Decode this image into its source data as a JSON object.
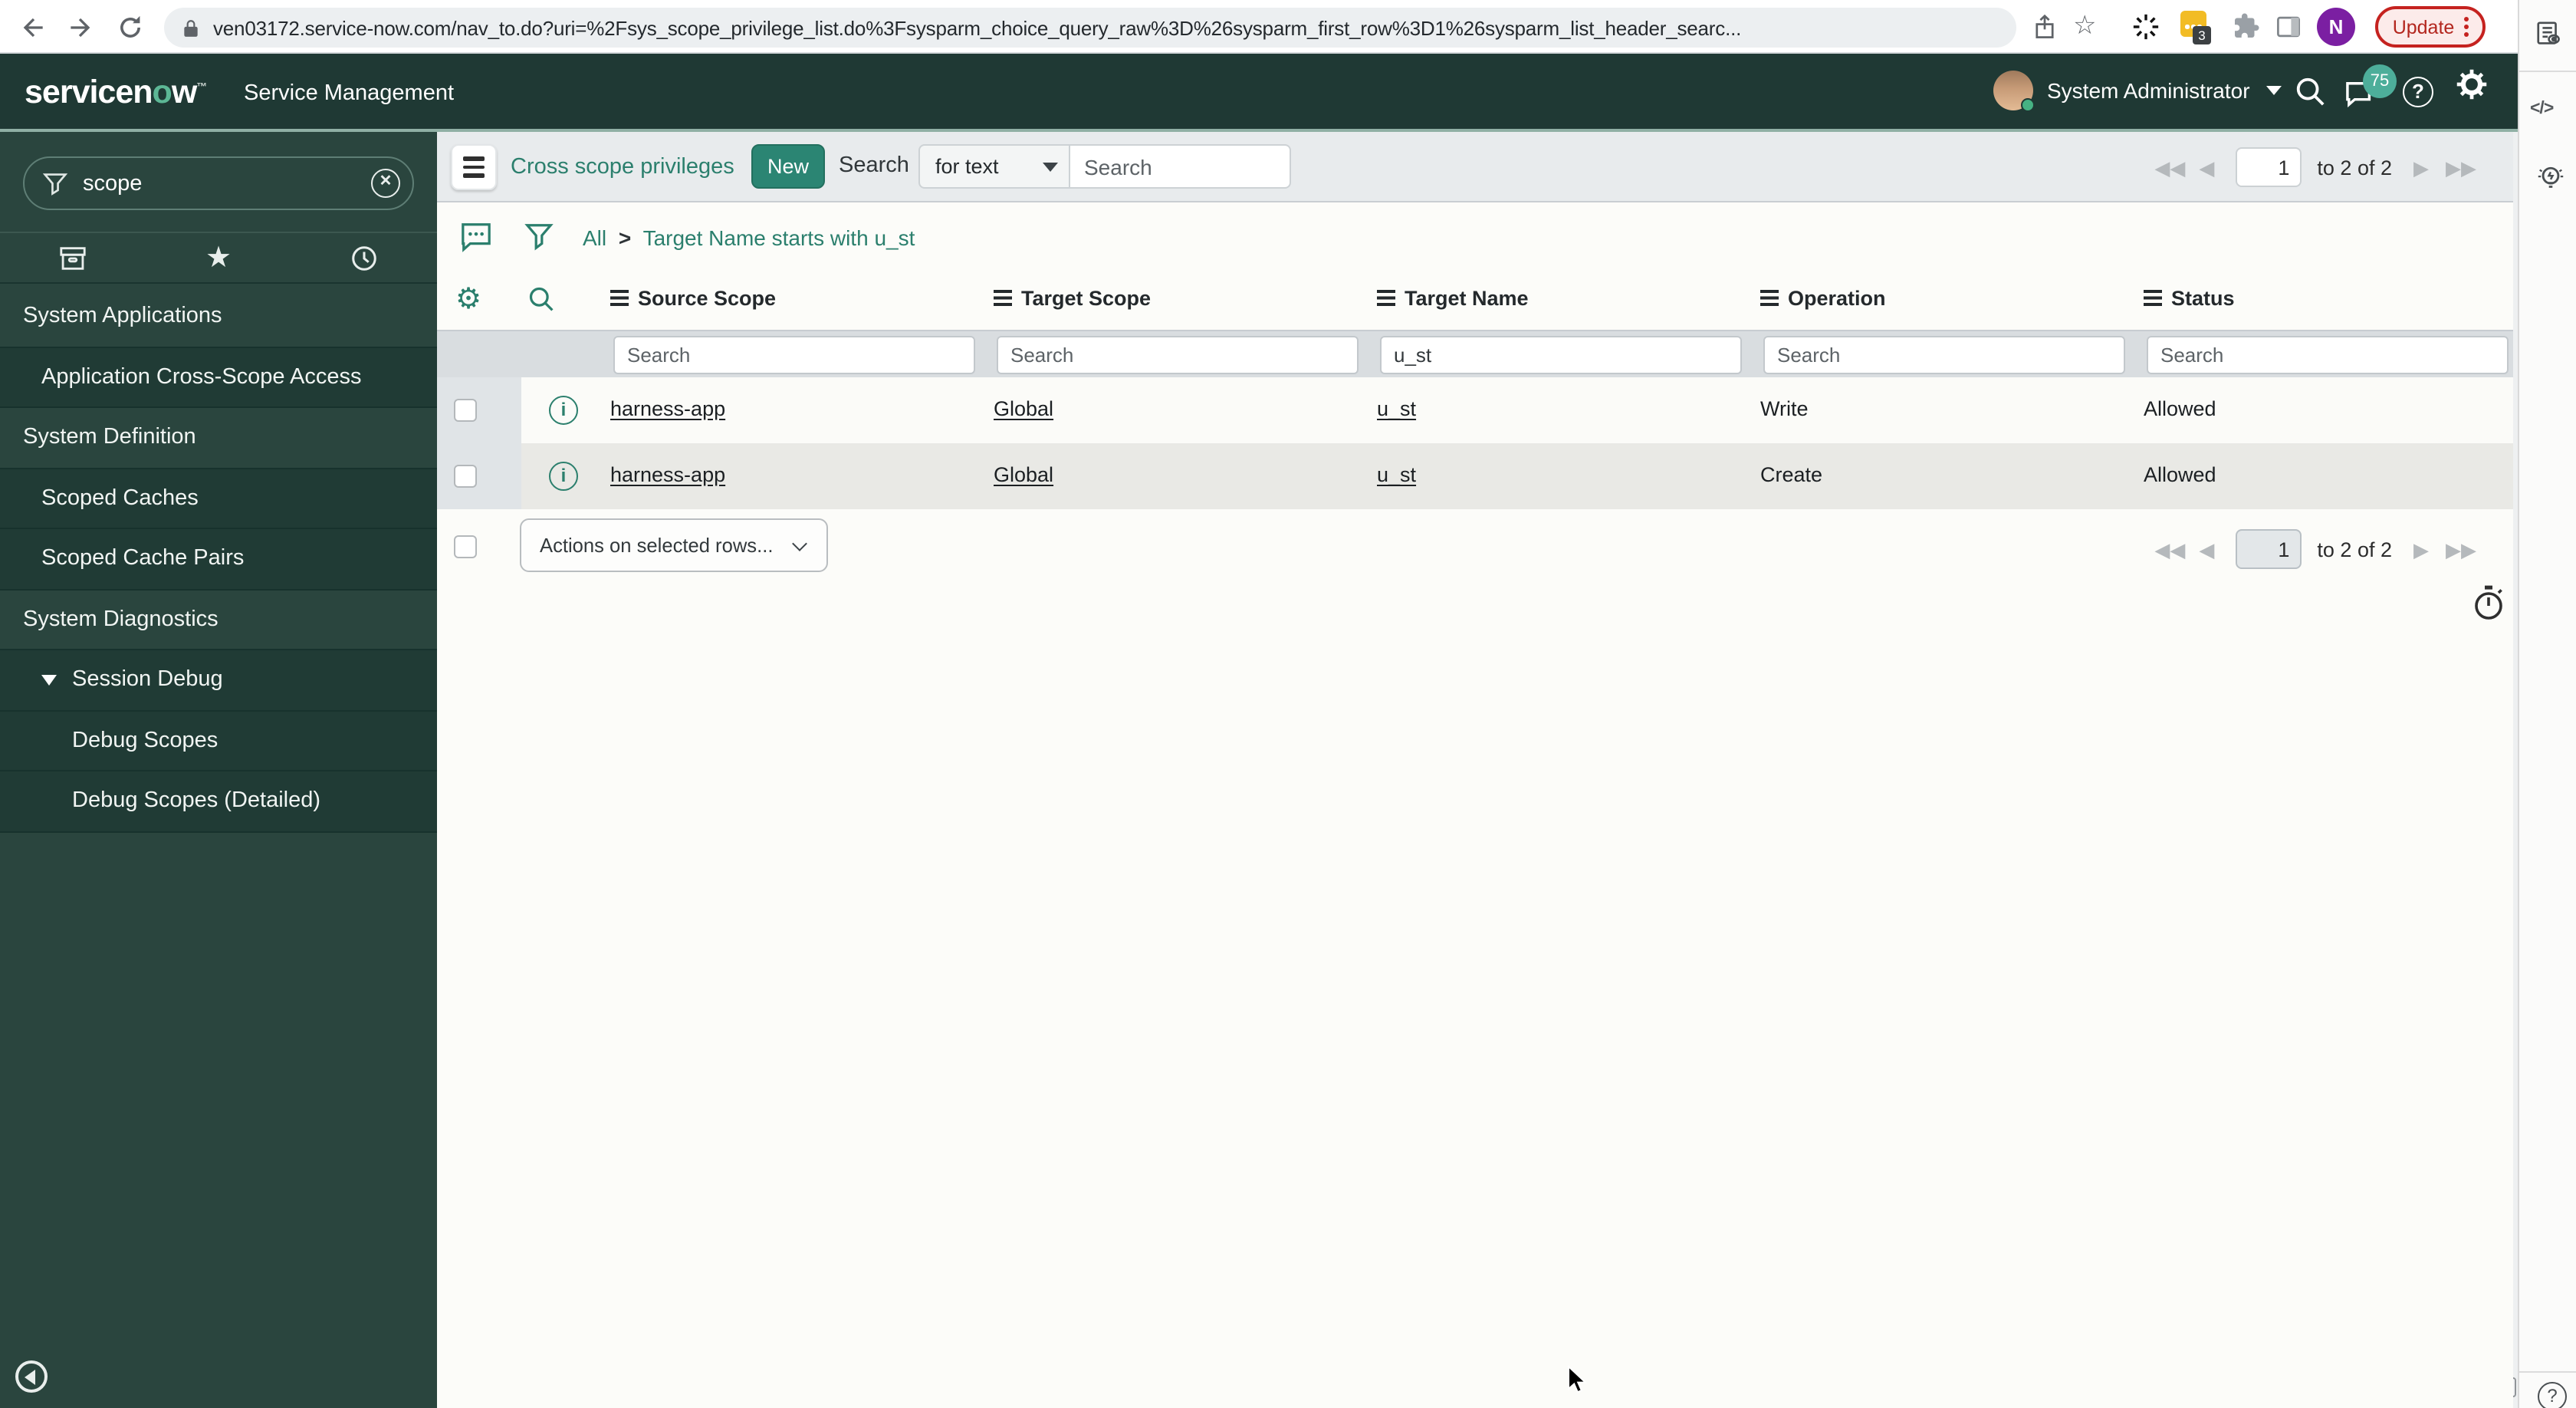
{
  "browser": {
    "url": "ven03172.service-now.com/nav_to.do?uri=%2Fsys_scope_privilege_list.do%3Fsysparm_choice_query_raw%3D%26sysparm_first_row%3D1%26sysparm_list_header_searc...",
    "update_label": "Update",
    "extension_badge": "3",
    "profile_initial": "N"
  },
  "app_header": {
    "logo_prefix": "servicen",
    "logo_o": "o",
    "logo_suffix": "w",
    "product_name": "Service Management",
    "user_name": "System Administrator",
    "notification_count": "75"
  },
  "nav_sidebar": {
    "filter_value": "scope",
    "items": [
      {
        "label": "System Applications"
      },
      {
        "label": "Application Cross-Scope Access"
      },
      {
        "label": "System Definition"
      },
      {
        "label": "Scoped Caches"
      },
      {
        "label": "Scoped Cache Pairs"
      },
      {
        "label": "System Diagnostics"
      },
      {
        "label": "Session Debug"
      },
      {
        "label": "Debug Scopes"
      },
      {
        "label": "Debug Scopes (Detailed)"
      }
    ]
  },
  "list_header": {
    "title": "Cross scope privileges",
    "new_button": "New",
    "search_label": "Search",
    "search_type": "for text",
    "search_placeholder": "Search",
    "page_value": "1",
    "page_range": "to 2 of 2"
  },
  "breadcrumb": {
    "root": "All",
    "separator": ">",
    "condition": "Target Name starts with u_st"
  },
  "grid": {
    "columns": [
      "Source Scope",
      "Target Scope",
      "Target Name",
      "Operation",
      "Status"
    ],
    "filter_placeholder": "Search",
    "filter_values": [
      "",
      "",
      "u_st",
      "",
      ""
    ],
    "rows": [
      {
        "source_scope": "harness-app",
        "target_scope": "Global",
        "target_name": "u_st",
        "operation": "Write",
        "status": "Allowed"
      },
      {
        "source_scope": "harness-app",
        "target_scope": "Global",
        "target_name": "u_st",
        "operation": "Create",
        "status": "Allowed"
      }
    ],
    "actions_placeholder": "Actions on selected rows...",
    "footer_page_value": "1",
    "footer_page_range": "to 2 of 2"
  }
}
